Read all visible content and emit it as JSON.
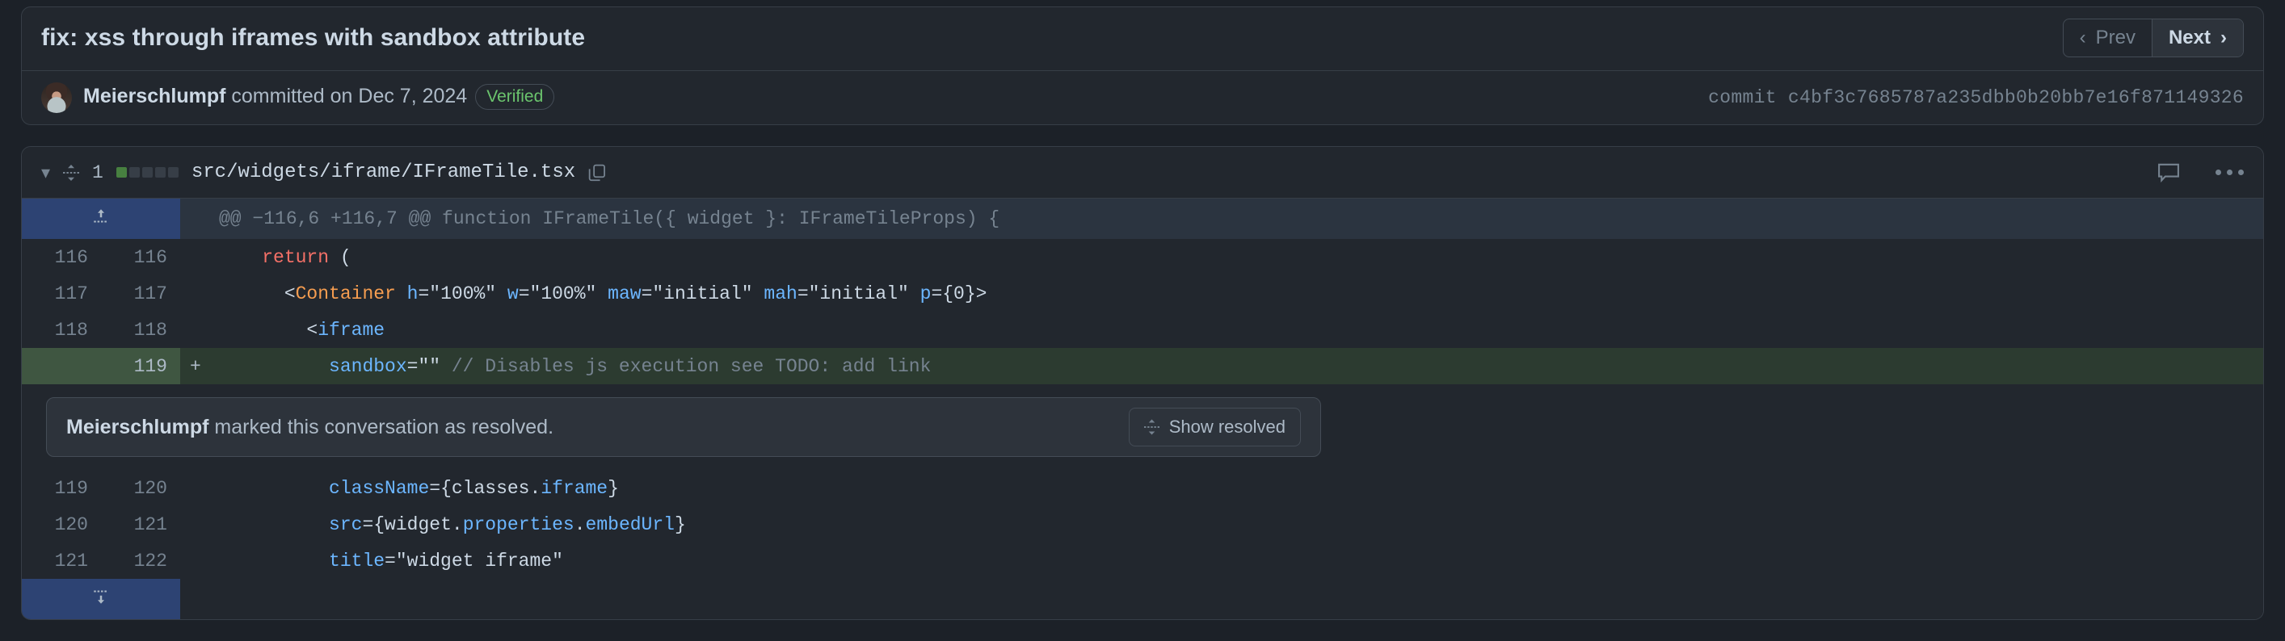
{
  "commit": {
    "title": "fix: xss through iframes with sandbox attribute",
    "nav": {
      "prev_label": "Prev",
      "next_label": "Next",
      "prev_icon": "chevron-left-icon",
      "next_icon": "chevron-right-icon"
    },
    "author": "Meierschlumpf",
    "committed_text": " committed on Dec 7, 2024",
    "verified_badge": "Verified",
    "commit_label": "commit",
    "sha": "c4bf3c7685787a235dbb0b20bb7e16f871149326"
  },
  "file": {
    "collapse_icon": "chevron-down-icon",
    "unfold_icon": "unfold-icon",
    "changes_count": "1",
    "diff_squares": [
      "add",
      "none",
      "none",
      "none",
      "none"
    ],
    "path": "src/widgets/iframe/IFrameTile.tsx",
    "copy_icon": "copy-icon",
    "comment_icon": "comment-icon",
    "more_icon": "kebab-menu-icon"
  },
  "hunk": {
    "expand_up_icon": "expand-up-icon",
    "header": "@@ −116,6 +116,7 @@ function IFrameTile({ widget }: IFrameTileProps) {"
  },
  "lines": [
    {
      "old": "116",
      "new": "116",
      "sign": "",
      "type": "ctx",
      "tokens": [
        {
          "t": "    ",
          "c": "plain"
        },
        {
          "t": "return",
          "c": "kw"
        },
        {
          "t": " (",
          "c": "plain"
        }
      ]
    },
    {
      "old": "117",
      "new": "117",
      "sign": "",
      "type": "ctx",
      "tokens": [
        {
          "t": "      <",
          "c": "plain"
        },
        {
          "t": "Container",
          "c": "tag"
        },
        {
          "t": " ",
          "c": "plain"
        },
        {
          "t": "h",
          "c": "attr"
        },
        {
          "t": "=\"100%\" ",
          "c": "plain"
        },
        {
          "t": "w",
          "c": "attr"
        },
        {
          "t": "=\"100%\" ",
          "c": "plain"
        },
        {
          "t": "maw",
          "c": "attr"
        },
        {
          "t": "=\"initial\" ",
          "c": "plain"
        },
        {
          "t": "mah",
          "c": "attr"
        },
        {
          "t": "=\"initial\" ",
          "c": "plain"
        },
        {
          "t": "p",
          "c": "attr"
        },
        {
          "t": "={0}>",
          "c": "plain"
        }
      ]
    },
    {
      "old": "118",
      "new": "118",
      "sign": "",
      "type": "ctx",
      "tokens": [
        {
          "t": "        <",
          "c": "plain"
        },
        {
          "t": "iframe",
          "c": "attr"
        }
      ]
    },
    {
      "old": "",
      "new": "119",
      "sign": "+",
      "type": "add",
      "tokens": [
        {
          "t": "          ",
          "c": "plain"
        },
        {
          "t": "sandbox",
          "c": "attr"
        },
        {
          "t": "=\"\" ",
          "c": "plain"
        },
        {
          "t": "// Disables js execution see TODO: add link",
          "c": "comment"
        }
      ]
    }
  ],
  "resolved": {
    "author": "Meierschlumpf",
    "message": " marked this conversation as resolved.",
    "button_label": "Show resolved",
    "button_icon": "unfold-icon"
  },
  "lines_after": [
    {
      "old": "119",
      "new": "120",
      "sign": "",
      "type": "ctx",
      "tokens": [
        {
          "t": "          ",
          "c": "plain"
        },
        {
          "t": "className",
          "c": "attr"
        },
        {
          "t": "={classes.",
          "c": "plain"
        },
        {
          "t": "iframe",
          "c": "attr"
        },
        {
          "t": "}",
          "c": "plain"
        }
      ]
    },
    {
      "old": "120",
      "new": "121",
      "sign": "",
      "type": "ctx",
      "tokens": [
        {
          "t": "          ",
          "c": "plain"
        },
        {
          "t": "src",
          "c": "attr"
        },
        {
          "t": "={widget.",
          "c": "plain"
        },
        {
          "t": "properties",
          "c": "attr"
        },
        {
          "t": ".",
          "c": "plain"
        },
        {
          "t": "embedUrl",
          "c": "attr"
        },
        {
          "t": "}",
          "c": "plain"
        }
      ]
    },
    {
      "old": "121",
      "new": "122",
      "sign": "",
      "type": "ctx",
      "tokens": [
        {
          "t": "          ",
          "c": "plain"
        },
        {
          "t": "title",
          "c": "attr"
        },
        {
          "t": "=\"widget iframe\"",
          "c": "plain"
        }
      ]
    }
  ],
  "expand_bottom": {
    "icon": "expand-down-icon"
  },
  "colors": {
    "page_bg": "#1c2128",
    "panel_bg": "#22272e",
    "border": "#373e47",
    "added_bg": "#2c3b30",
    "added_gutter": "#3f5641",
    "expand_blue": "#2d4373",
    "green_accent": "#478040",
    "verified_green": "#6bc46d",
    "text_primary": "#cdd9e5",
    "text_muted": "#768390",
    "kw_red": "#f47067",
    "tag_orange": "#f69d50",
    "attr_blue": "#6cb6ff"
  }
}
